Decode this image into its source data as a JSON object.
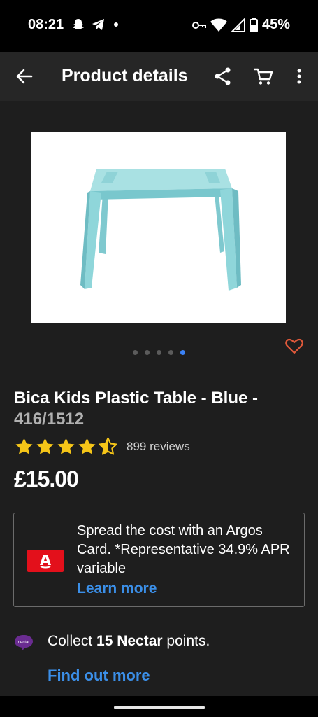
{
  "status_bar": {
    "time": "08:21",
    "battery": "45%",
    "icons": [
      "snapchat-icon",
      "telegram-icon",
      "dot-icon",
      "key-icon",
      "wifi-icon",
      "signal-icon",
      "battery-icon"
    ]
  },
  "app_bar": {
    "title": "Product details",
    "icons": [
      "back-arrow-icon",
      "share-icon",
      "cart-icon",
      "more-vert-icon"
    ]
  },
  "product": {
    "image_icon": "kids-table-image",
    "carousel": {
      "total": 5,
      "active": 5
    },
    "title": "Bica Kids Plastic Table - Blue -",
    "code": "416/1512",
    "rating": 4.5,
    "reviews": "899 reviews",
    "price": "£15.00"
  },
  "finance": {
    "icon": "argos-card-icon",
    "text": "Spread the cost with an Argos Card. *Representative 34.9% APR variable",
    "link": "Learn more"
  },
  "nectar": {
    "icon": "nectar-icon",
    "prefix": "Collect ",
    "points": "15 Nectar",
    "suffix": " points.",
    "link": "Find out more"
  },
  "colors": {
    "background": "#1e1e1e",
    "app_bar": "#262626",
    "link": "#3b8fe8",
    "star": "#f5c518",
    "favorite": "#e0593a",
    "argos_red": "#e3101b"
  }
}
